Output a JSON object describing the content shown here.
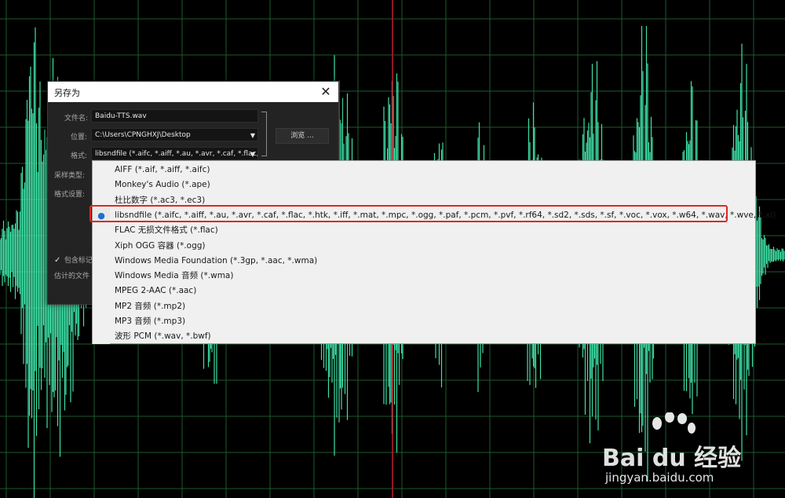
{
  "dialog": {
    "title": "另存为",
    "close_icon": "close-icon",
    "filename_label": "文件名:",
    "filename_value": "Baidu-TTS.wav",
    "location_label": "位置:",
    "location_value": "C:\\Users\\CPNGHXJ\\Desktop",
    "browse_label": "浏览 ...",
    "format_label": "格式:",
    "format_value": "libsndfile (*.aifc, *.aiff, *.au, *.avr, *.caf, *.flac, *",
    "sample_type_label": "采样类型:",
    "format_settings_label": "格式设置:",
    "include_markers_label": "包含标记",
    "estimated_size_label": "估计的文件"
  },
  "dropdown": {
    "items": [
      {
        "label": "AIFF (*.aif, *.aiff, *.aifc)",
        "selected": false
      },
      {
        "label": "Monkey's Audio (*.ape)",
        "selected": false
      },
      {
        "label": "杜比数字 (*.ac3, *.ec3)",
        "selected": false
      },
      {
        "label": "libsndfile (*.aifc, *.aiff, *.au, *.avr, *.caf, *.flac, *.htk, *.iff, *.mat, *.mpc, *.ogg, *.paf, *.pcm, *.pvf, *.rf64, *.sd2, *.sds, *.sf, *.voc, *.vox, *.w64, *.wav, *.wve, *.xi)",
        "selected": true
      },
      {
        "label": "FLAC 无损文件格式 (*.flac)",
        "selected": false
      },
      {
        "label": "Xiph OGG 容器 (*.ogg)",
        "selected": false
      },
      {
        "label": "Windows Media Foundation (*.3gp, *.aac, *.wma)",
        "selected": false
      },
      {
        "label": "Windows Media 音频 (*.wma)",
        "selected": false
      },
      {
        "label": "MPEG 2-AAC (*.aac)",
        "selected": false
      },
      {
        "label": "MP2 音频 (*.mp2)",
        "selected": false
      },
      {
        "label": "MP3 音频 (*.mp3)",
        "selected": false
      },
      {
        "label": "波形 PCM (*.wav, *.bwf)",
        "selected": false
      }
    ]
  },
  "watermark": {
    "brand": "Bai du 经验",
    "url": "jingyan.baidu.com"
  },
  "colors": {
    "waveform": "#3fe0a6",
    "grid": "#1d5a2c",
    "playhead": "#c21e2a",
    "highlight": "#e0281f"
  }
}
